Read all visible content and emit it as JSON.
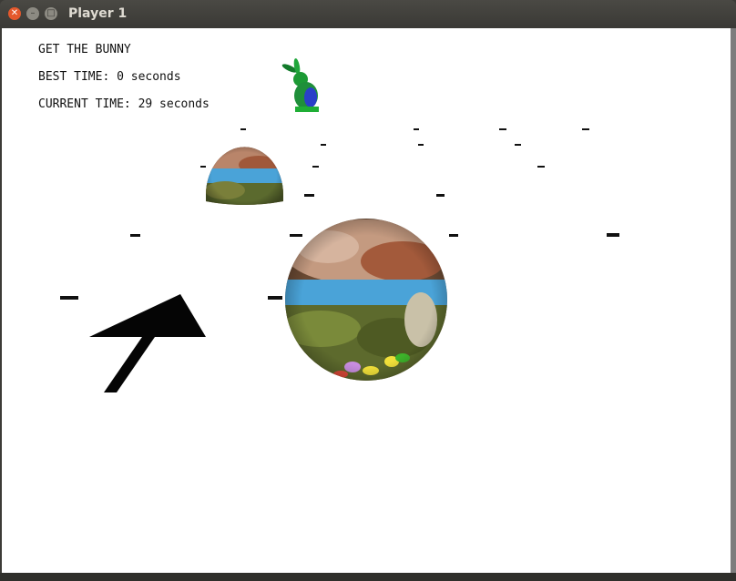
{
  "window": {
    "title": "Player 1"
  },
  "hud": {
    "title": "GET THE BUNNY",
    "best_time": "BEST TIME: 0 seconds",
    "current_time": "CURRENT TIME: 29 seconds"
  },
  "colors": {
    "titlebar": "#3c3b37",
    "close": "#e4582c",
    "sky": "#4aa3d8",
    "bunny": "#1fa63a"
  }
}
